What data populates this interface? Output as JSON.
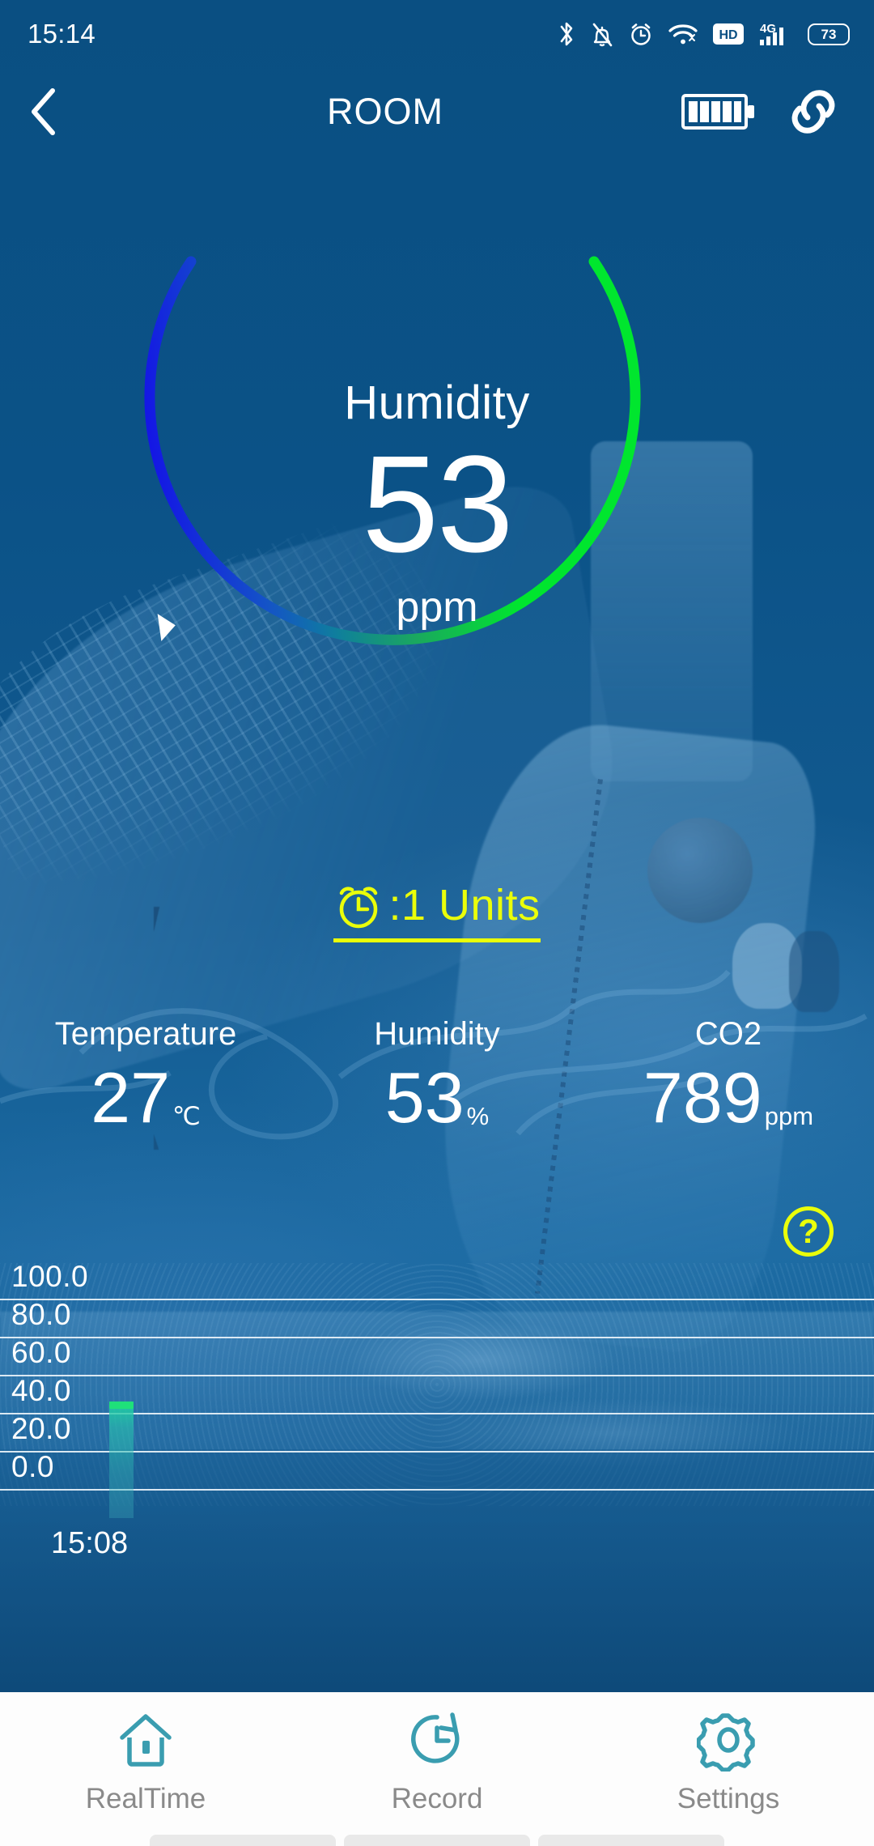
{
  "statusbar": {
    "clock": "15:14",
    "icons": [
      "bluetooth-icon",
      "bell-muted-icon",
      "alarm-clock-icon",
      "wifi-icon",
      "hd-icon",
      "4g-signal-icon",
      "battery-percent-icon"
    ],
    "network_label": "4G",
    "hd_label": "HD",
    "battery_percent": "73"
  },
  "header": {
    "back_icon": "chevron-left-icon",
    "title": "ROOM",
    "battery_icon": "battery-full-icon",
    "link_icon": "link-chain-icon"
  },
  "gauge": {
    "label": "Humidity",
    "value": "53",
    "unit": "ppm",
    "min": 0,
    "max": 100,
    "marker_value": 53,
    "start_color": "#00e62e",
    "mid_color": "#0f8fa0",
    "end_color": "#1414e6",
    "marker_icon": "gauge-pointer-triangle"
  },
  "alarm": {
    "icon": "alarm-clock-icon",
    "text": ":1 Units",
    "color": "#eaff0a"
  },
  "readings": [
    {
      "name": "Temperature",
      "value": "27",
      "unit": "℃"
    },
    {
      "name": "Humidity",
      "value": "53",
      "unit": "%"
    },
    {
      "name": "CO2",
      "value": "789",
      "unit": "ppm"
    }
  ],
  "help": {
    "icon": "question-mark-icon",
    "label": "?",
    "color": "#eaff0a"
  },
  "chart_data": {
    "type": "bar",
    "title": "",
    "xlabel": "",
    "ylabel": "",
    "categories": [
      "15:08"
    ],
    "values": [
      46
    ],
    "series": [
      {
        "name": "Humidity",
        "values": [
          46
        ]
      }
    ],
    "yticks": [
      "100.0",
      "80.0",
      "60.0",
      "40.0",
      "20.0",
      "0.0"
    ],
    "ytick_values": [
      100.0,
      80.0,
      60.0,
      40.0,
      20.0,
      0.0
    ],
    "ylim": [
      0,
      100
    ],
    "grid": true,
    "legend": "none",
    "bar_color": "#1fe07a",
    "gridline_color": "#e9f2f8"
  },
  "bottomnav": {
    "items": [
      {
        "label": "RealTime",
        "icon": "home-icon",
        "active": true
      },
      {
        "label": "Record",
        "icon": "clock-rotate-icon",
        "active": false
      },
      {
        "label": "Settings",
        "icon": "gear-icon",
        "active": false
      }
    ],
    "accent": "#3a9db0"
  }
}
